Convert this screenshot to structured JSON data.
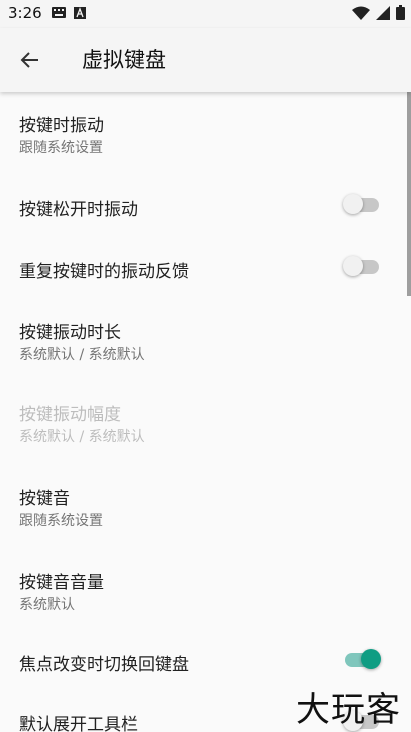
{
  "status_bar": {
    "time": "3:26",
    "left_icons": [
      "keyboard-icon",
      "a-icon"
    ],
    "right_icons": [
      "wifi-icon",
      "signal-icon",
      "battery-icon"
    ]
  },
  "app_bar": {
    "title": "虚拟键盘",
    "back_icon": "arrow-left-icon"
  },
  "preferences": [
    {
      "title": "按键时振动",
      "summary": "跟随系统设置"
    },
    {
      "title": "按键松开时振动",
      "switch": false
    },
    {
      "title": "重复按键时的振动反馈",
      "switch": false
    },
    {
      "title": "按键振动时长",
      "summary": "系统默认 / 系统默认"
    },
    {
      "title": "按键振动幅度",
      "summary": "系统默认 / 系统默认",
      "enabled": false
    },
    {
      "title": "按键音",
      "summary": "跟随系统设置"
    },
    {
      "title": "按键音音量",
      "summary": "系统默认"
    },
    {
      "title": "焦点改变时切换回键盘",
      "switch": true
    },
    {
      "title": "默认展开工具栏",
      "switch": false
    }
  ],
  "watermark": "大玩客",
  "colors": {
    "accent": "#0f9d83",
    "accent_track": "#7fc6bc",
    "background": "#fafafa",
    "bar": "#f5f5f5"
  }
}
